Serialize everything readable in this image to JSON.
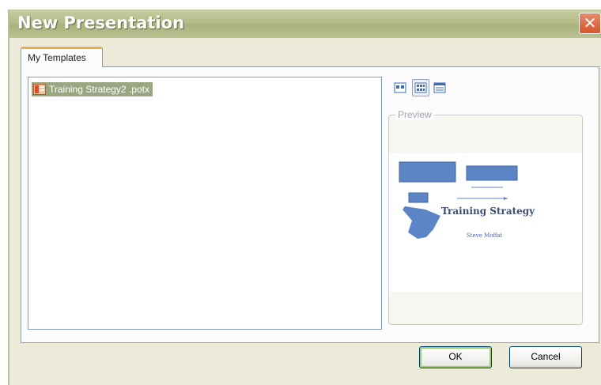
{
  "window": {
    "title": "New Presentation",
    "close_symbol": "✕"
  },
  "tabs": [
    {
      "label": "My Templates"
    }
  ],
  "templates": [
    {
      "name": "Training Strategy2 .potx",
      "icon": "powerpoint-template-icon"
    }
  ],
  "view_buttons": [
    "large-icons-view-icon",
    "list-view-icon",
    "details-view-icon"
  ],
  "preview": {
    "label": "Preview",
    "slide_title": "Training Strategy",
    "slide_subtitle": "Steve Moffat"
  },
  "buttons": {
    "ok": "OK",
    "cancel": "Cancel"
  },
  "colors": {
    "accent_shape": "#5b85c6",
    "selection": "#9aa582",
    "title_bar": "#b4bc89"
  }
}
